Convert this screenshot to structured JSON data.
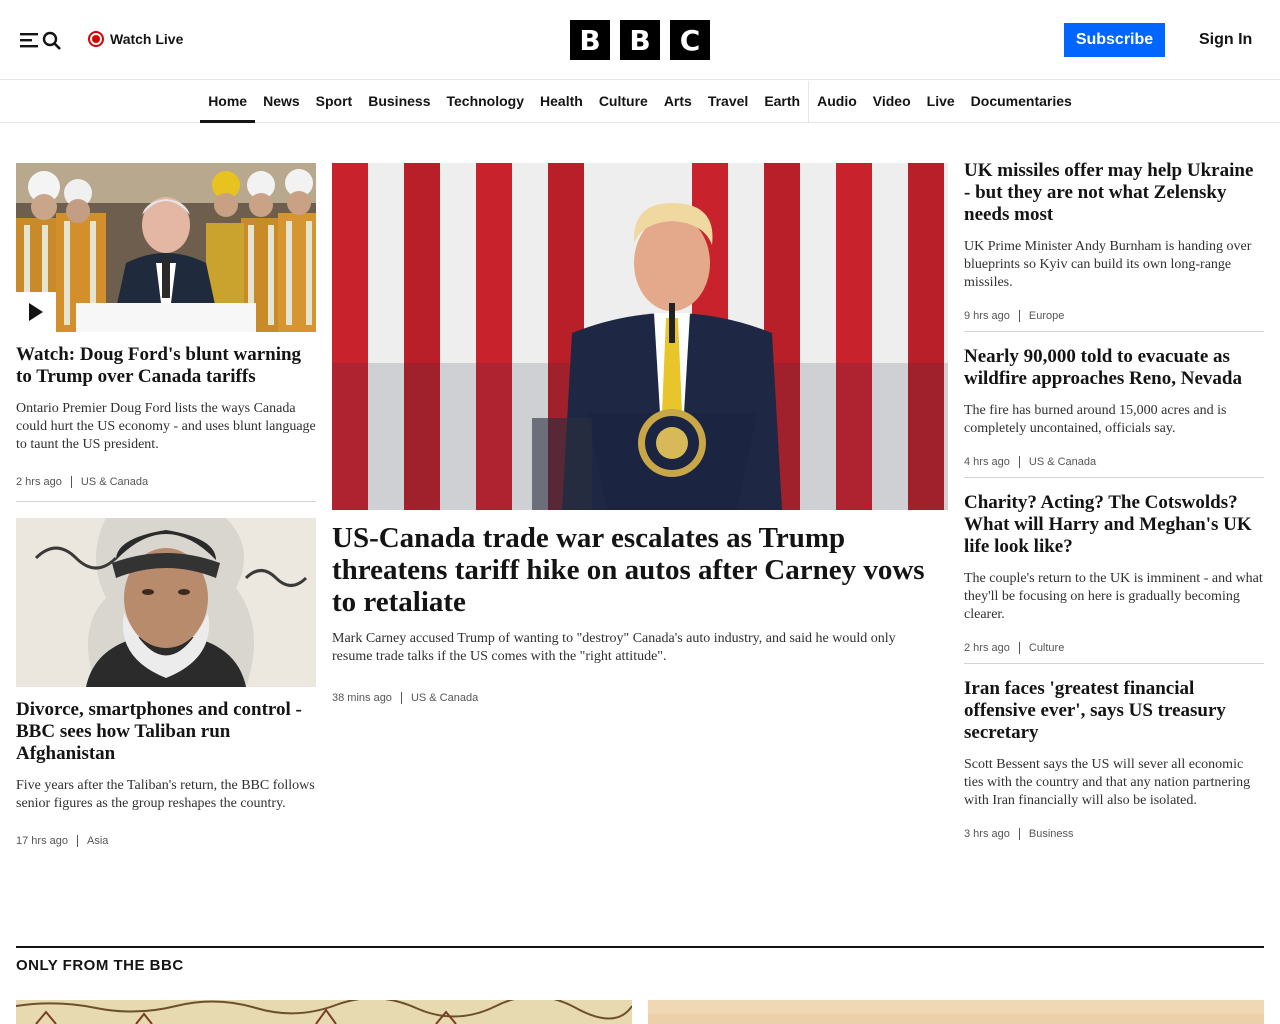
{
  "header": {
    "watch_live": "Watch Live",
    "logo_letters": [
      "B",
      "B",
      "C"
    ],
    "subscribe": "Subscribe",
    "sign_in": "Sign In",
    "accent": "#0066ff",
    "live_color": "#d90000"
  },
  "nav": {
    "items": [
      "Home",
      "News",
      "Sport",
      "Business",
      "Technology",
      "Health",
      "Culture",
      "Arts",
      "Travel",
      "Earth",
      "Audio",
      "Video",
      "Live",
      "Documentaries"
    ],
    "active": "Home"
  },
  "left": {
    "story1": {
      "headline": "Watch: Doug Ford's blunt warning to Trump over Canada tariffs",
      "summary": "Ontario Premier Doug Ford lists the ways Canada could hurt the US economy - and uses blunt language to taunt the US president.",
      "time": "2 hrs ago",
      "category": "US & Canada"
    },
    "story2": {
      "headline": "Divorce, smartphones and control - BBC sees how Taliban run Afghanistan",
      "summary": "Five years after the Taliban's return, the BBC follows senior figures as the group reshapes the country.",
      "time": "17 hrs ago",
      "category": "Asia"
    }
  },
  "center": {
    "headline": "US-Canada trade war escalates as Trump threatens tariff hike on autos after Carney vows to retaliate",
    "summary": "Mark Carney accused Trump of wanting to \"destroy\" Canada's auto industry, and said he would only resume trade talks if the US comes with the \"right attitude\".",
    "time": "38 mins ago",
    "category": "US & Canada"
  },
  "right": {
    "stories": [
      {
        "headline": "UK missiles offer may help Ukraine - but they are not what Zelensky needs most",
        "summary": "UK Prime Minister Andy Burnham is handing over blueprints so Kyiv can build its own long-range missiles.",
        "time": "9 hrs ago",
        "category": "Europe"
      },
      {
        "headline": "Nearly 90,000 told to evacuate as wildfire approaches Reno, Nevada",
        "summary": "The fire has burned around 15,000 acres and is completely uncontained, officials say.",
        "time": "4 hrs ago",
        "category": "US & Canada"
      },
      {
        "headline": "Charity? Acting? The Cotswolds? What will Harry and Meghan's UK life look like?",
        "summary": "The couple's return to the UK is imminent - and what they'll be focusing on here is gradually becoming clearer.",
        "time": "2 hrs ago",
        "category": "Culture"
      },
      {
        "headline": "Iran faces 'greatest financial offensive ever', says US treasury secretary",
        "summary": "Scott Bessent says the US will sever all economic ties with the country and that any nation partnering with Iran financially will also be isolated.",
        "time": "3 hrs ago",
        "category": "Business"
      }
    ]
  },
  "section": {
    "title": "ONLY FROM THE BBC"
  }
}
